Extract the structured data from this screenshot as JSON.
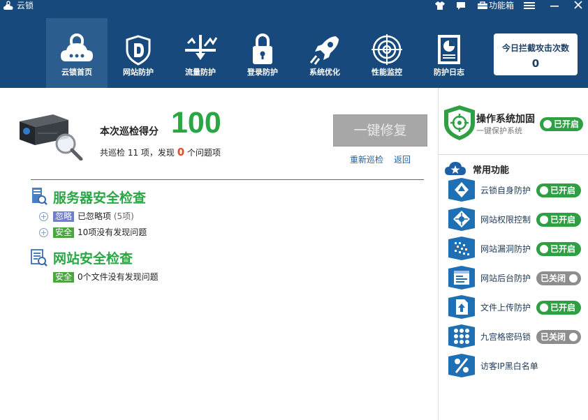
{
  "window": {
    "title": "云锁",
    "menu_label": "功能箱"
  },
  "nav": {
    "items": [
      {
        "label": "云锁首页",
        "icon": "cloud-lock-icon",
        "active": true
      },
      {
        "label": "网站防护",
        "icon": "shield-d-icon",
        "active": false
      },
      {
        "label": "流量防护",
        "icon": "traffic-icon",
        "active": false
      },
      {
        "label": "登录防护",
        "icon": "padlock-icon",
        "active": false
      },
      {
        "label": "系统优化",
        "icon": "rocket-icon",
        "active": false
      },
      {
        "label": "性能监控",
        "icon": "radar-icon",
        "active": false
      },
      {
        "label": "防护日志",
        "icon": "log-icon",
        "active": false
      }
    ]
  },
  "attack_stats": {
    "label": "今日拦截攻击次数",
    "value": "0"
  },
  "scan": {
    "score_label": "本次巡检得分",
    "score": "100",
    "summary_prefix": "共巡检 11 项，发现",
    "issue_count": "0",
    "summary_suffix": "个问题项",
    "fix_button": "一键修复",
    "rescan_link": "重新巡检",
    "back_link": "返回"
  },
  "server_check": {
    "title": "服务器安全检查",
    "rows": [
      {
        "tag": "忽略",
        "text": "已忽略项",
        "extra": "(5项)"
      },
      {
        "tag": "安全",
        "text": "10项没有发现问题"
      }
    ]
  },
  "site_check": {
    "title": "网站安全检查",
    "rows": [
      {
        "tag": "安全",
        "text": "0个文件没有发现问题"
      }
    ]
  },
  "os_hardening": {
    "title": "操作系统加固",
    "subtitle": "一键保护系统",
    "status": "已开启"
  },
  "common_features": {
    "title": "常用功能",
    "items": [
      {
        "label": "云锁自身防护",
        "status": "已开启",
        "on": true,
        "icon": "self-protect-icon"
      },
      {
        "label": "网站权限控制",
        "status": "已开启",
        "on": true,
        "icon": "permission-icon"
      },
      {
        "label": "网站漏洞防护",
        "status": "已开启",
        "on": true,
        "icon": "vulnerability-icon"
      },
      {
        "label": "网站后台防护",
        "status": "已关闭",
        "on": false,
        "icon": "backend-icon"
      },
      {
        "label": "文件上传防护",
        "status": "已开启",
        "on": true,
        "icon": "upload-icon"
      },
      {
        "label": "九宫格密码锁",
        "status": "已关闭",
        "on": false,
        "icon": "grid-lock-icon"
      },
      {
        "label": "访客IP黑白名单",
        "icon": "ip-list-icon"
      }
    ]
  },
  "colors": {
    "header": "#17497c",
    "active_nav": "#2c5d8f",
    "accent_green": "#28a744",
    "toggle_on": "#2ea043",
    "toggle_off": "#8d8d8d",
    "issue_red": "#e74c2a"
  }
}
